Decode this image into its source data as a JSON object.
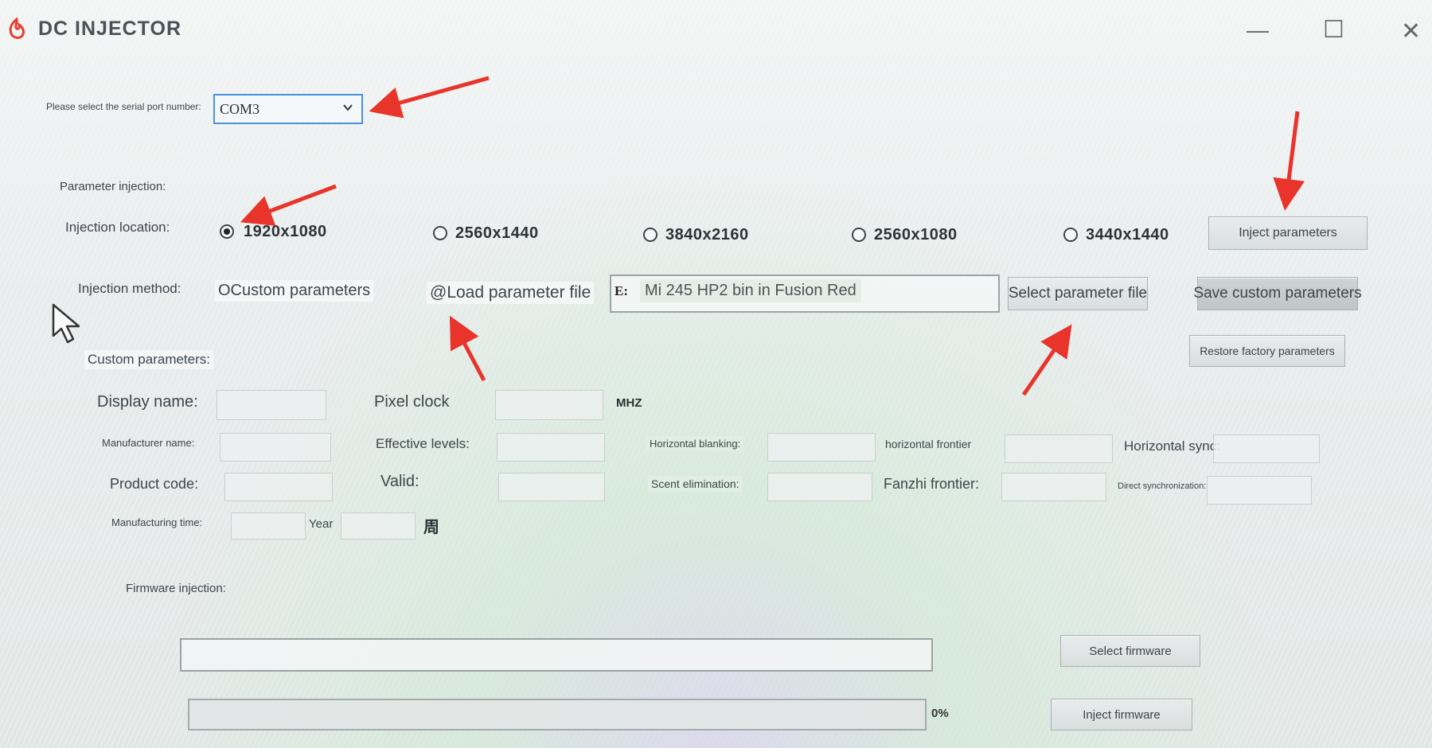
{
  "window": {
    "title": "DC INJECTOR",
    "minimize_glyph": "—",
    "maximize_glyph": "☐",
    "close_glyph": "✕",
    "logo_icon": "flame-logo-icon"
  },
  "serial": {
    "label": "Please select the serial port number:",
    "value": "COM3"
  },
  "parameter_injection": {
    "section_label": "Parameter injection:",
    "location_label": "Injection location:",
    "resolutions": [
      {
        "label": "1920x1080",
        "selected": true
      },
      {
        "label": "2560x1440",
        "selected": false
      },
      {
        "label": "3840x2160",
        "selected": false
      },
      {
        "label": "2560x1080",
        "selected": false
      },
      {
        "label": "3440x1440",
        "selected": false
      }
    ],
    "inject_button": "Inject parameters",
    "method_label": "Injection method:",
    "method_custom": "OCustom parameters",
    "method_load": "@Load parameter file",
    "file_prefix": "E:",
    "file_value": "Mi 245 HP2 bin in Fusion Red",
    "select_file_button": "Select parameter file",
    "save_custom_button": "Save custom parameters",
    "restore_button": "Restore factory parameters"
  },
  "custom": {
    "section_label": "Custom parameters:",
    "display_name": "Display name:",
    "pixel_clock": "Pixel clock",
    "mhz": "MHZ",
    "manufacturer_name": "Manufacturer name:",
    "effective_levels": "Effective levels:",
    "horizontal_blanking": "Horizontal blanking:",
    "horizontal_frontier": "horizontal frontier",
    "horizontal_sync": "Horizontal sync:",
    "product_code": "Product code:",
    "valid": "Valid:",
    "scent_elimination": "Scent elimination:",
    "fanzhi_frontier": "Fanzhi frontier:",
    "direct_sync": "Direct synchronization:",
    "manufacturing_time": "Manufacturing time:",
    "year": "Year",
    "week_glyph": "周"
  },
  "firmware": {
    "section_label": "Firmware injection:",
    "select_button": "Select firmware",
    "inject_button": "Inject firmware",
    "progress_text": "0%",
    "progress": 0
  },
  "colors": {
    "arrow": "#e8342a",
    "accent_border": "#4a90d9"
  }
}
